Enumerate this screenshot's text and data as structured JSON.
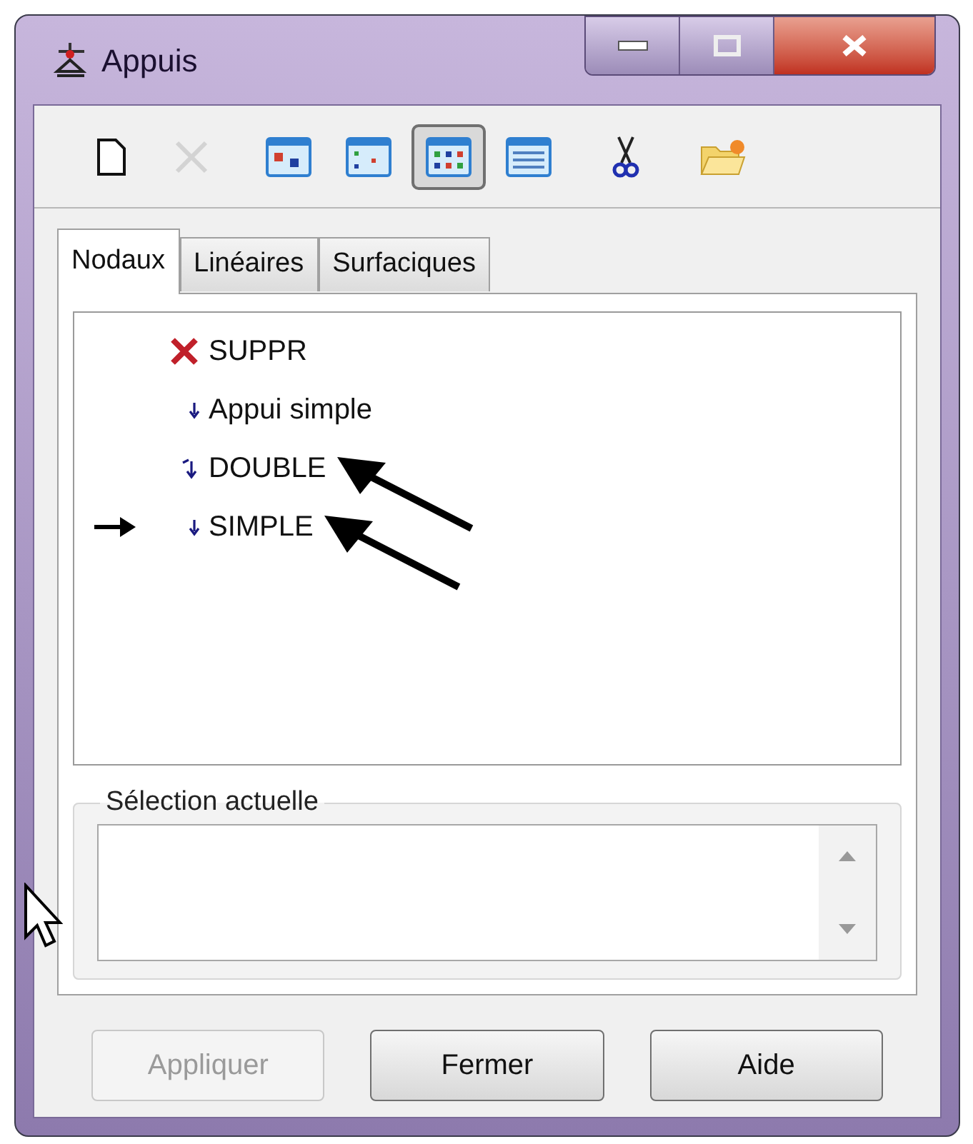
{
  "window": {
    "title": "Appuis"
  },
  "toolbar": [
    {
      "kind": "new",
      "disabled": false,
      "selected": false
    },
    {
      "kind": "delete",
      "disabled": true,
      "selected": false
    },
    {
      "kind": "view-large",
      "disabled": false,
      "selected": false
    },
    {
      "kind": "view-small",
      "disabled": false,
      "selected": false
    },
    {
      "kind": "view-list",
      "disabled": false,
      "selected": true
    },
    {
      "kind": "view-details",
      "disabled": false,
      "selected": false
    },
    {
      "kind": "cut",
      "disabled": false,
      "selected": false
    },
    {
      "kind": "folder",
      "disabled": false,
      "selected": false
    }
  ],
  "tabs": [
    {
      "label": "Nodaux",
      "selected": true
    },
    {
      "label": "Linéaires",
      "selected": false
    },
    {
      "label": "Surfaciques",
      "selected": false
    }
  ],
  "items": [
    {
      "label": "SUPPR",
      "kind": "delete",
      "pointed": false,
      "annotated": false
    },
    {
      "label": "Appui simple",
      "kind": "simple",
      "pointed": false,
      "annotated": false
    },
    {
      "label": "DOUBLE",
      "kind": "double",
      "pointed": false,
      "annotated": true
    },
    {
      "label": "SIMPLE",
      "kind": "simple",
      "pointed": true,
      "annotated": true
    }
  ],
  "selection": {
    "title": "Sélection actuelle"
  },
  "buttons": [
    {
      "label": "Appliquer",
      "disabled": true
    },
    {
      "label": "Fermer",
      "disabled": false
    },
    {
      "label": "Aide",
      "disabled": false
    }
  ]
}
